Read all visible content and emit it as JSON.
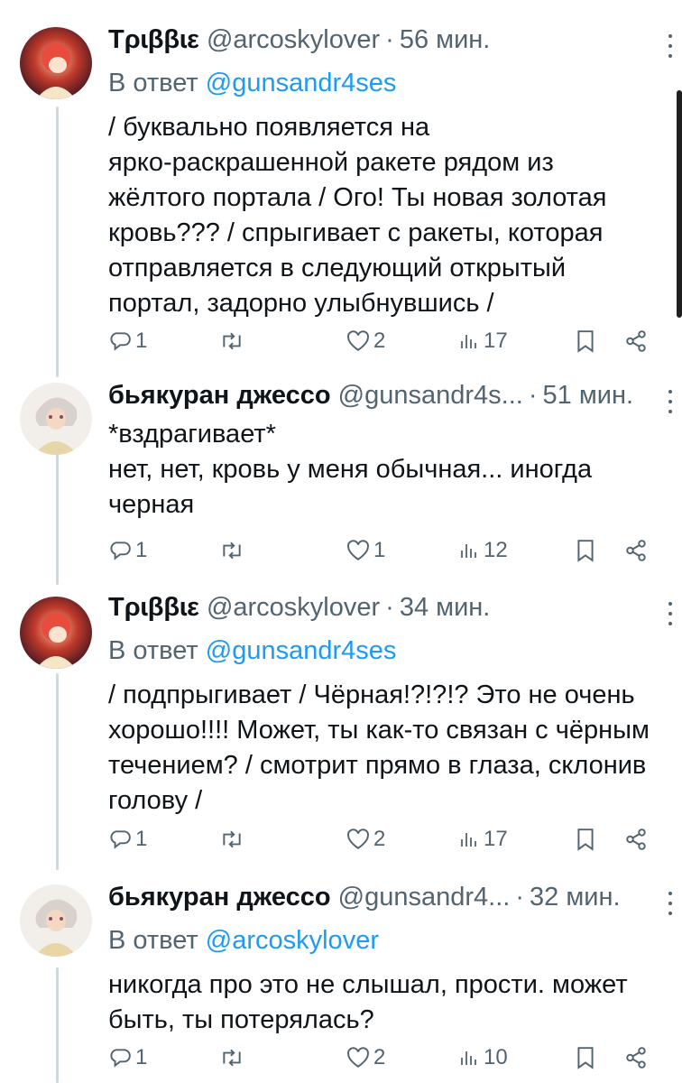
{
  "tweets": [
    {
      "name": "Tρɩββɩε",
      "handle": "@arcoskylover",
      "time": "56 мин.",
      "reply_prefix": "В ответ",
      "reply_to": "@gunsandr4ses",
      "lines": [
        "/ буквально появляется на",
        "ярко-раскрашенной ракете рядом из",
        "жёлтого портала / Ого! Ты новая золотая",
        "кровь??? / спрыгивает с ракеты, которая",
        "отправляется в следующий открытый",
        "портал, задорно улыбнувшись /"
      ],
      "replies": "1",
      "retweets": "",
      "likes": "2",
      "views": "17"
    },
    {
      "name": "бьякуран джессо",
      "handle": "@gunsandr4s...",
      "time": "51 мин.",
      "lines": [
        "*вздрагивает*",
        "нет, нет, кровь у меня обычная... иногда",
        "черная"
      ],
      "replies": "1",
      "retweets": "",
      "likes": "1",
      "views": "12"
    },
    {
      "name": "Tρɩββɩε",
      "handle": "@arcoskylover",
      "time": "34 мин.",
      "reply_prefix": "В ответ",
      "reply_to": "@gunsandr4ses",
      "lines": [
        "/ подпрыгивает / Чёрная!?!?!? Это не очень",
        "хорошо!!!! Может, ты как-то связан с чёрным",
        "течением? / смотрит прямо в глаза, склонив",
        "голову /"
      ],
      "replies": "1",
      "retweets": "",
      "likes": "2",
      "views": "17"
    },
    {
      "name": "бьякуран джессо",
      "handle": "@gunsandr4...",
      "time": "32 мин.",
      "reply_prefix": "В ответ",
      "reply_to": "@arcoskylover",
      "lines": [
        "никогда про это не слышал, прости. может",
        "быть, ты потерялась?"
      ],
      "replies": "1",
      "retweets": "",
      "likes": "2",
      "views": "10"
    }
  ],
  "colors": {
    "text": "#0f1419",
    "secondary": "#536471",
    "mention": "#1d9bf0",
    "thread_line": "#cfd9de"
  }
}
